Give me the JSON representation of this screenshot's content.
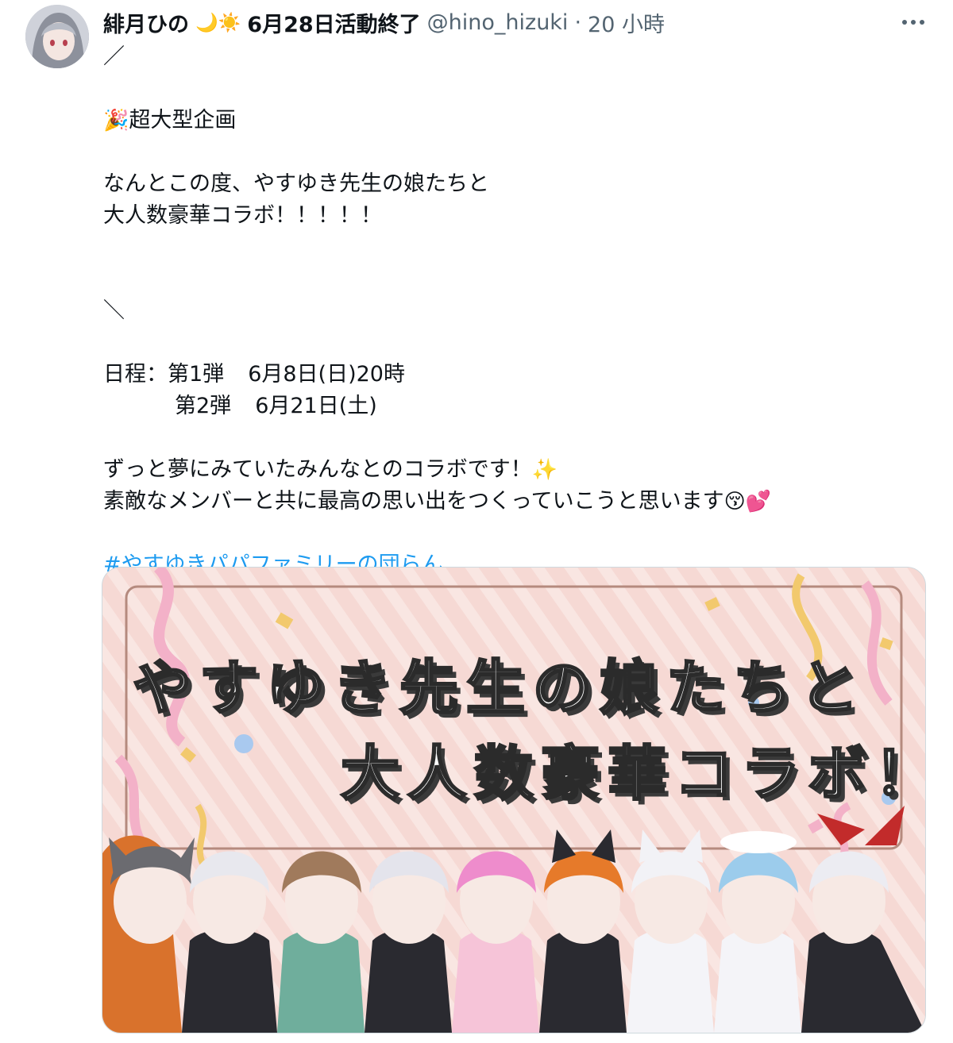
{
  "author": {
    "display_name": "緋月ひの",
    "name_emoji": "🌙☀️",
    "name_suffix": "6月28日活動終了",
    "handle": "@hino_hizuki",
    "separator": "·",
    "timestamp": "20 小時"
  },
  "more_icon": "more-horizontal-icon",
  "tweet": {
    "open_slash": "／",
    "headline_emoji": "🎉",
    "headline": "超大型企画",
    "intro_line1": "なんとこの度、やすゆき先生の娘たちと",
    "intro_line2": "大人数豪華コラボ！！！！！",
    "close_slash": "＼",
    "schedule_label": "日程：",
    "round1_label": "第1弾",
    "round1_date": "6月8日(日)20時",
    "round2_label": "第2弾",
    "round2_date": "6月21日(土)",
    "dream_line": "ずっと夢にみていたみんなとのコラボです！",
    "dream_emoji": "✨",
    "members_line": "素敵なメンバーと共に最高の思い出をつくっていこうと思います",
    "members_emoji": "😚💕",
    "hashtag": "#やすゆきパパファミリーの団らん"
  },
  "media": {
    "banner_line1": "やすゆき先生の娘たちと",
    "banner_line2": "大人数豪華コラボ！",
    "background_color": "#f6d9d4",
    "character_hair_colors": [
      "#6b6b70",
      "#e8e8ee",
      "#a07a5c",
      "#e4e4ec",
      "#ee8ccc",
      "#e67a2a",
      "#f2f2f6",
      "#9cccec",
      "#ececf2"
    ],
    "character_count": 9
  },
  "colors": {
    "hashtag": "#1d9bf0",
    "muted_text": "#536471",
    "border": "#cfd9de"
  }
}
